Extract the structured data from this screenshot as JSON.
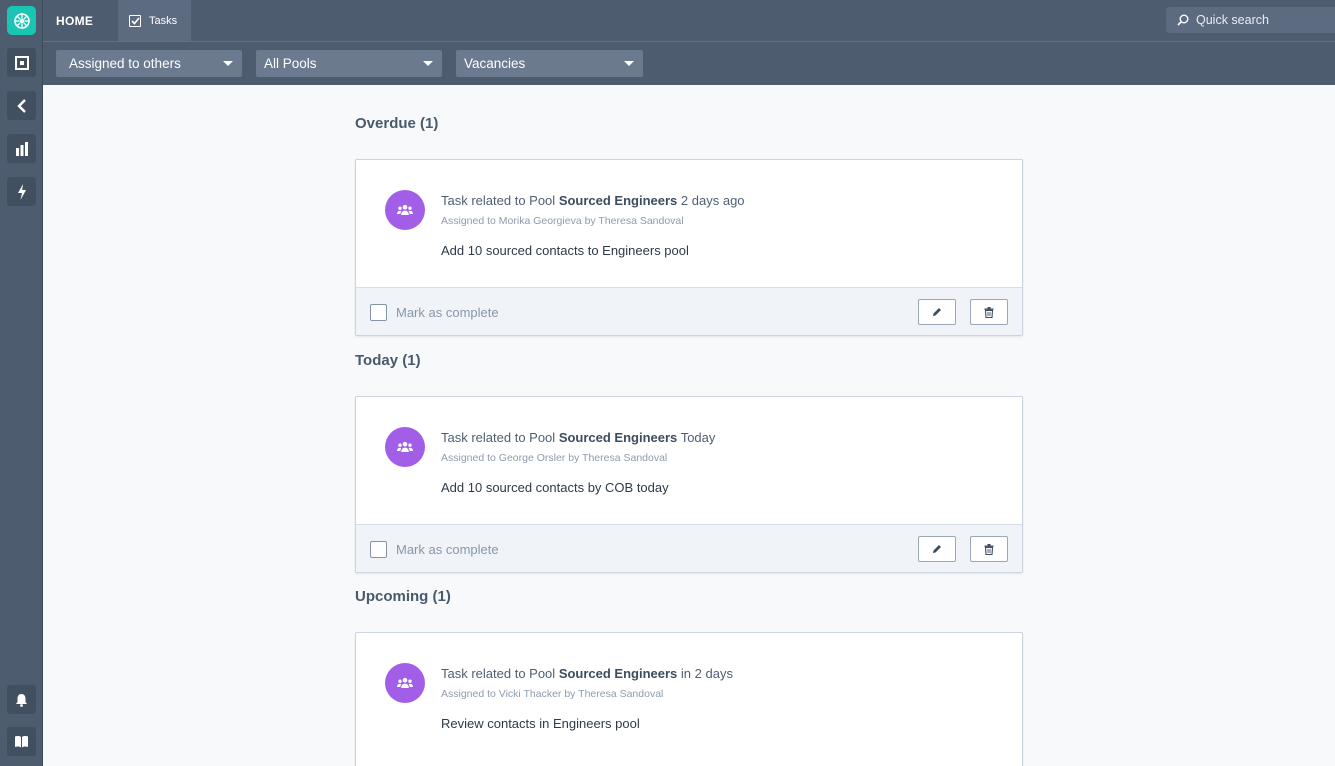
{
  "nav": {
    "home_label": "HOME",
    "tasks_tab_label": "Tasks",
    "search_placeholder": "Quick search",
    "sidebar_icons": [
      "app-logo-icon",
      "square-icon",
      "chevron-left-icon",
      "bar-chart-icon",
      "lightning-icon",
      "bell-icon",
      "book-icon"
    ]
  },
  "filters": {
    "assignee": "Assigned to others",
    "pool": "All Pools",
    "type": "Vacancies"
  },
  "sections": [
    {
      "title": "Overdue (1)",
      "task": {
        "prefix": "Task related to Pool",
        "pool_name": "Sourced Engineers",
        "when": "2 days ago",
        "assigned": "Assigned to Morika Georgieva by Theresa Sandoval",
        "description": "Add 10 sourced contacts to Engineers pool",
        "mark_label": "Mark as complete"
      }
    },
    {
      "title": "Today (1)",
      "task": {
        "prefix": "Task related to Pool",
        "pool_name": "Sourced Engineers",
        "when": "Today",
        "assigned": "Assigned to George Orsler by Theresa Sandoval",
        "description": "Add 10 sourced contacts by COB today",
        "mark_label": "Mark as complete"
      }
    },
    {
      "title": "Upcoming (1)",
      "task": {
        "prefix": "Task related to Pool",
        "pool_name": "Sourced Engineers",
        "when": "in 2 days",
        "assigned": "Assigned to Vicki Thacker by Theresa Sandoval",
        "description": "Review contacts in Engineers pool"
      }
    }
  ],
  "colors": {
    "sidebar_bg": "#4d5c6f",
    "logo_teal": "#1bc5b4",
    "avatar_purple": "#a35ee8",
    "page_bg": "#f7f9fb"
  }
}
